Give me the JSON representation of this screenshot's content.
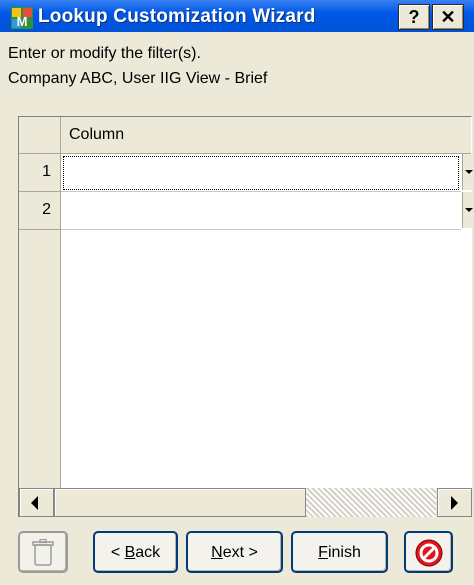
{
  "window": {
    "title": "Lookup Customization Wizard",
    "help_label": "?",
    "close_label": "✕",
    "title_bar_color": "#0055e5"
  },
  "instructions": {
    "line1": "Enter or modify the filter(s).",
    "line2": "Company ABC, User IIG View - Brief"
  },
  "grid": {
    "column_header": "Column",
    "rows": [
      {
        "number": "1",
        "value": ""
      },
      {
        "number": "2",
        "value": ""
      }
    ]
  },
  "buttons": {
    "back_accel": "B",
    "back_rest": "ack",
    "next_accel": "N",
    "next_rest": "ext >",
    "finish_accel": "F",
    "finish_rest": "inish"
  },
  "icons": {
    "app": "wizard-app-icon",
    "delete": "trash-can-icon",
    "cancel": "cancel-icon"
  }
}
